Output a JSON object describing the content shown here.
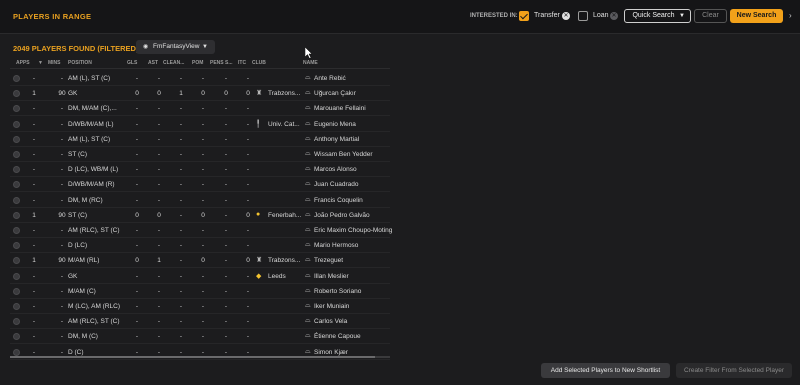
{
  "topbar": {
    "title": "PLAYERS IN RANGE",
    "interested_in": "INTERESTED IN:",
    "transfer_label": "Transfer",
    "loan_label": "Loan",
    "quick_search_label": "Quick Search",
    "clear_label": "Clear",
    "new_search_label": "New Search",
    "more_icon": "›"
  },
  "list_header": {
    "found_text": "2049 PLAYERS FOUND (FILTERED)",
    "view_label": "FmFantasyView"
  },
  "columns": {
    "apps": "APPS",
    "mins": "MINS",
    "position": "POSITION",
    "gls": "GLS",
    "ast": "AST",
    "clean": "CLEAN...",
    "pom": "POM",
    "pens": "PENS S...",
    "itc": "ITC",
    "club": "CLUB",
    "name": "NAME"
  },
  "rows": [
    {
      "apps": "-",
      "mins": "-",
      "position": "AM (L), ST (C)",
      "gls": "-",
      "ast": "-",
      "clean": "-",
      "pom": "-",
      "pens": "-",
      "itc": "-",
      "club": "",
      "badge": "",
      "name": "Ante Rebić"
    },
    {
      "apps": "1",
      "mins": "90",
      "position": "GK",
      "gls": "0",
      "ast": "0",
      "clean": "1",
      "pom": "0",
      "pens": "0",
      "itc": "0",
      "club": "Trabzons...",
      "badge": "trabzonspor-badge",
      "name": "Uğurcan Çakır"
    },
    {
      "apps": "-",
      "mins": "-",
      "position": "DM, M/AM (C),...",
      "gls": "-",
      "ast": "-",
      "clean": "-",
      "pom": "-",
      "pens": "-",
      "itc": "-",
      "club": "",
      "badge": "",
      "name": "Marouane Fellaini"
    },
    {
      "apps": "-",
      "mins": "-",
      "position": "D/WB/M/AM (L)",
      "gls": "-",
      "ast": "-",
      "clean": "-",
      "pom": "-",
      "pens": "-",
      "itc": "-",
      "club": "Univ. Cat...",
      "badge": "univ-catolica-badge",
      "name": "Eugenio Mena"
    },
    {
      "apps": "-",
      "mins": "-",
      "position": "AM (L), ST (C)",
      "gls": "-",
      "ast": "-",
      "clean": "-",
      "pom": "-",
      "pens": "-",
      "itc": "-",
      "club": "",
      "badge": "",
      "name": "Anthony Martial"
    },
    {
      "apps": "-",
      "mins": "-",
      "position": "ST (C)",
      "gls": "-",
      "ast": "-",
      "clean": "-",
      "pom": "-",
      "pens": "-",
      "itc": "-",
      "club": "",
      "badge": "",
      "name": "Wissam Ben Yedder"
    },
    {
      "apps": "-",
      "mins": "-",
      "position": "D (LC), WB/M (L)",
      "gls": "-",
      "ast": "-",
      "clean": "-",
      "pom": "-",
      "pens": "-",
      "itc": "-",
      "club": "",
      "badge": "",
      "name": "Marcos Alonso"
    },
    {
      "apps": "-",
      "mins": "-",
      "position": "D/WB/M/AM (R)",
      "gls": "-",
      "ast": "-",
      "clean": "-",
      "pom": "-",
      "pens": "-",
      "itc": "-",
      "club": "",
      "badge": "",
      "name": "Juan Cuadrado"
    },
    {
      "apps": "-",
      "mins": "-",
      "position": "DM, M (RC)",
      "gls": "-",
      "ast": "-",
      "clean": "-",
      "pom": "-",
      "pens": "-",
      "itc": "-",
      "club": "",
      "badge": "",
      "name": "Francis Coquelin"
    },
    {
      "apps": "1",
      "mins": "90",
      "position": "ST (C)",
      "gls": "0",
      "ast": "0",
      "clean": "-",
      "pom": "0",
      "pens": "-",
      "itc": "0",
      "club": "Fenerbah...",
      "badge": "fenerbahce-badge",
      "name": "João Pedro Galvão"
    },
    {
      "apps": "-",
      "mins": "-",
      "position": "AM (RLC), ST (C)",
      "gls": "-",
      "ast": "-",
      "clean": "-",
      "pom": "-",
      "pens": "-",
      "itc": "-",
      "club": "",
      "badge": "",
      "name": "Eric Maxim Choupo-Moting"
    },
    {
      "apps": "-",
      "mins": "-",
      "position": "D (LC)",
      "gls": "-",
      "ast": "-",
      "clean": "-",
      "pom": "-",
      "pens": "-",
      "itc": "-",
      "club": "",
      "badge": "",
      "name": "Mario Hermoso"
    },
    {
      "apps": "1",
      "mins": "90",
      "position": "M/AM (RL)",
      "gls": "0",
      "ast": "1",
      "clean": "-",
      "pom": "0",
      "pens": "-",
      "itc": "0",
      "club": "Trabzons...",
      "badge": "trabzonspor-badge",
      "name": "Trezeguet"
    },
    {
      "apps": "-",
      "mins": "-",
      "position": "GK",
      "gls": "-",
      "ast": "-",
      "clean": "-",
      "pom": "-",
      "pens": "-",
      "itc": "-",
      "club": "Leeds",
      "badge": "leeds-badge",
      "name": "Illan Meslier"
    },
    {
      "apps": "-",
      "mins": "-",
      "position": "M/AM (C)",
      "gls": "-",
      "ast": "-",
      "clean": "-",
      "pom": "-",
      "pens": "-",
      "itc": "-",
      "club": "",
      "badge": "",
      "name": "Roberto Soriano"
    },
    {
      "apps": "-",
      "mins": "-",
      "position": "M (LC), AM (RLC)",
      "gls": "-",
      "ast": "-",
      "clean": "-",
      "pom": "-",
      "pens": "-",
      "itc": "-",
      "club": "",
      "badge": "",
      "name": "Iker Muniain"
    },
    {
      "apps": "-",
      "mins": "-",
      "position": "AM (RLC), ST (C)",
      "gls": "-",
      "ast": "-",
      "clean": "-",
      "pom": "-",
      "pens": "-",
      "itc": "-",
      "club": "",
      "badge": "",
      "name": "Carlos Vela"
    },
    {
      "apps": "-",
      "mins": "-",
      "position": "DM, M (C)",
      "gls": "-",
      "ast": "-",
      "clean": "-",
      "pom": "-",
      "pens": "-",
      "itc": "-",
      "club": "",
      "badge": "",
      "name": "Étienne Capoue"
    },
    {
      "apps": "-",
      "mins": "-",
      "position": "D (C)",
      "gls": "-",
      "ast": "-",
      "clean": "-",
      "pom": "-",
      "pens": "-",
      "itc": "-",
      "club": "",
      "badge": "",
      "name": "Simon Kjær"
    }
  ],
  "bottom": {
    "add_shortlist_label": "Add Selected Players to New Shortlist",
    "create_filter_label": "Create Filter From Selected Player"
  },
  "colors": {
    "accent": "#f2a11a",
    "background": "#1c1c1e"
  }
}
